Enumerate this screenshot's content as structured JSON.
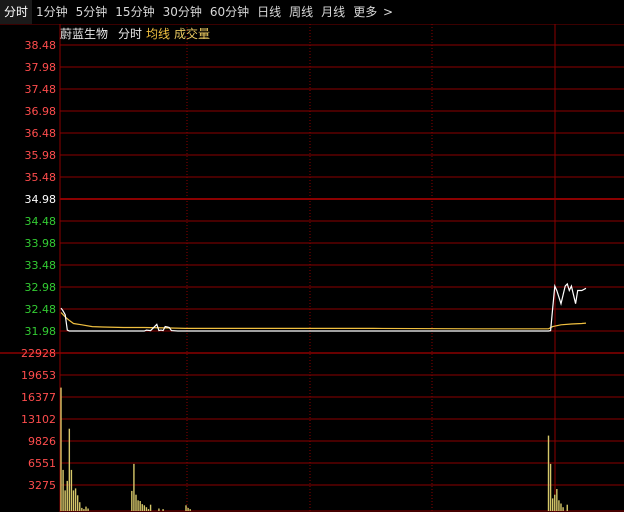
{
  "tabs": [
    {
      "label": "分时",
      "active": true
    },
    {
      "label": "1分钟"
    },
    {
      "label": "5分钟"
    },
    {
      "label": "15分钟"
    },
    {
      "label": "30分钟"
    },
    {
      "label": "60分钟"
    },
    {
      "label": "日线"
    },
    {
      "label": "周线"
    },
    {
      "label": "月线"
    },
    {
      "label": "更多"
    }
  ],
  "more_icon": "chevron-right-icon",
  "legend": {
    "stock_name": "蔚蓝生物",
    "mode": "分时",
    "avg_label": "均线",
    "volume_label": "成交量"
  },
  "colors": {
    "background": "#000000",
    "grid": "#8b0000",
    "up": "#ff4d4d",
    "down": "#33cc33",
    "neutral": "#ffffff",
    "price_line": "#ffffff",
    "avg_line": "#f0c040",
    "volume_bar": "#d6c86a"
  },
  "chart_data": [
    {
      "type": "line",
      "title": "蔚蓝生物 分时",
      "y_ticks": [
        "38.48",
        "37.98",
        "37.48",
        "36.98",
        "36.48",
        "35.98",
        "35.48",
        "34.98",
        "34.48",
        "33.98",
        "33.48",
        "32.98",
        "32.48",
        "31.98"
      ],
      "prev_close": 34.98,
      "ylim": [
        31.98,
        38.48
      ],
      "series": [
        {
          "name": "分时",
          "values": [
            32.5,
            32.45,
            32.3,
            32.0,
            31.98,
            31.98,
            31.98,
            31.98,
            31.98,
            31.98,
            31.98,
            32.15,
            31.98,
            32.1,
            31.98,
            31.98,
            31.98,
            31.98,
            31.98,
            31.98,
            32.98,
            32.5,
            33.0,
            32.8,
            32.85,
            32.6,
            32.8,
            32.8
          ]
        },
        {
          "name": "均线",
          "values": [
            32.4,
            32.3,
            32.2,
            32.18,
            32.15,
            32.12,
            32.1,
            32.08,
            32.07,
            32.06,
            32.05,
            32.05,
            32.05,
            32.05,
            32.05,
            32.05,
            32.05,
            32.05,
            32.04,
            32.04,
            32.1,
            32.12,
            32.14,
            32.16,
            32.17,
            32.18,
            32.18,
            32.19
          ]
        }
      ]
    },
    {
      "type": "bar",
      "title": "成交量",
      "y_ticks": [
        "22928",
        "19653",
        "16377",
        "13102",
        "9826",
        "6551",
        "3275"
      ],
      "ylim": [
        0,
        22928
      ],
      "series": [
        {
          "name": "成交量",
          "values": [
            19653,
            6551,
            3275,
            4800,
            13102,
            6551,
            3275,
            3600,
            2500,
            1400,
            500,
            300,
            700,
            400,
            3200,
            7500,
            2600,
            1700,
            1600,
            1100,
            900,
            600,
            300,
            1000,
            12000,
            7500,
            2000,
            2600,
            3500,
            1700,
            1200,
            600
          ]
        }
      ]
    }
  ],
  "price_points": [
    [
      0,
      32.5
    ],
    [
      0.8,
      32.45
    ],
    [
      2,
      32.35
    ],
    [
      3,
      32.0
    ],
    [
      4,
      31.98
    ],
    [
      7,
      31.98
    ],
    [
      10,
      31.98
    ],
    [
      12,
      31.98
    ],
    [
      14,
      31.98
    ],
    [
      18,
      31.98
    ],
    [
      22,
      31.98
    ],
    [
      24,
      31.98
    ],
    [
      25,
      31.98
    ],
    [
      26,
      31.98
    ],
    [
      28,
      31.98
    ],
    [
      30,
      31.98
    ],
    [
      40,
      31.98
    ],
    [
      41,
      32.0
    ],
    [
      43,
      31.99
    ],
    [
      46,
      32.13
    ],
    [
      47,
      31.99
    ],
    [
      48,
      32.0
    ],
    [
      49,
      31.99
    ],
    [
      50,
      32.08
    ],
    [
      51,
      32.07
    ],
    [
      52,
      32.06
    ],
    [
      53,
      31.99
    ],
    [
      56,
      31.98
    ],
    [
      60,
      31.98
    ],
    [
      200,
      31.98
    ],
    [
      234,
      31.98
    ],
    [
      235,
      31.99
    ],
    [
      236,
      32.5
    ],
    [
      237,
      33.0
    ],
    [
      238,
      32.9
    ],
    [
      240,
      32.6
    ],
    [
      241,
      32.8
    ],
    [
      242,
      33.0
    ],
    [
      243,
      33.05
    ],
    [
      244,
      32.9
    ],
    [
      245,
      33.0
    ],
    [
      247,
      32.6
    ],
    [
      248,
      32.9
    ],
    [
      250,
      32.9
    ],
    [
      252,
      32.95
    ]
  ],
  "avg_points": [
    [
      0,
      32.4
    ],
    [
      1,
      32.35
    ],
    [
      2,
      32.3
    ],
    [
      4,
      32.22
    ],
    [
      6,
      32.15
    ],
    [
      10,
      32.12
    ],
    [
      15,
      32.08
    ],
    [
      20,
      32.07
    ],
    [
      30,
      32.06
    ],
    [
      40,
      32.06
    ],
    [
      50,
      32.05
    ],
    [
      60,
      32.04
    ],
    [
      100,
      32.04
    ],
    [
      150,
      32.04
    ],
    [
      200,
      32.03
    ],
    [
      234,
      32.03
    ],
    [
      236,
      32.08
    ],
    [
      240,
      32.12
    ],
    [
      245,
      32.14
    ],
    [
      250,
      32.15
    ],
    [
      252,
      32.16
    ]
  ],
  "volume_points": [
    [
      0,
      19653
    ],
    [
      1,
      6551
    ],
    [
      2,
      3275
    ],
    [
      3,
      4800
    ],
    [
      4,
      13102
    ],
    [
      5,
      6551
    ],
    [
      6,
      3275
    ],
    [
      7,
      3600
    ],
    [
      8,
      2500
    ],
    [
      9,
      1400
    ],
    [
      10,
      500
    ],
    [
      11,
      300
    ],
    [
      12,
      700
    ],
    [
      13,
      400
    ],
    [
      34,
      3200
    ],
    [
      35,
      7500
    ],
    [
      36,
      2600
    ],
    [
      37,
      1700
    ],
    [
      38,
      1600
    ],
    [
      39,
      1100
    ],
    [
      40,
      900
    ],
    [
      41,
      600
    ],
    [
      42,
      300
    ],
    [
      43,
      1000
    ],
    [
      47,
      400
    ],
    [
      49,
      300
    ],
    [
      60,
      900
    ],
    [
      61,
      500
    ],
    [
      62,
      300
    ],
    [
      234,
      12000
    ],
    [
      235,
      7500
    ],
    [
      236,
      2000
    ],
    [
      237,
      2600
    ],
    [
      238,
      3500
    ],
    [
      239,
      1700
    ],
    [
      240,
      1200
    ],
    [
      241,
      600
    ],
    [
      243,
      1000
    ]
  ]
}
